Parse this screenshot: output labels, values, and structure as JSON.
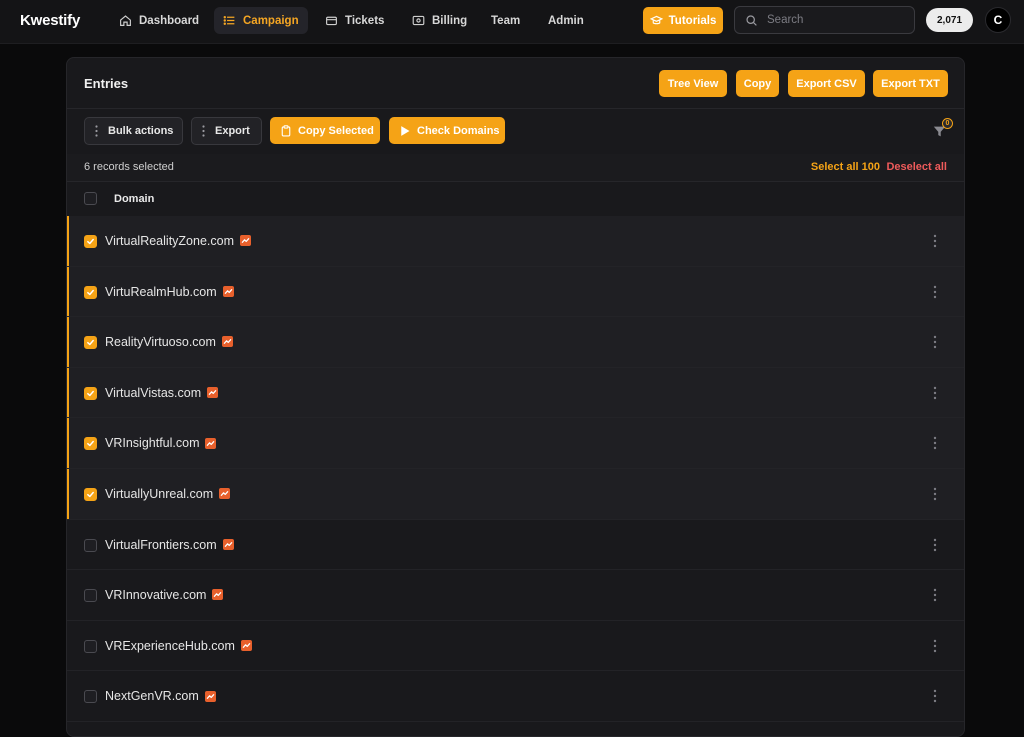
{
  "app": {
    "brand": "Kwestify"
  },
  "nav": {
    "items": [
      {
        "label": "Dashboard",
        "icon": "home-icon"
      },
      {
        "label": "Campaign",
        "icon": "list-icon",
        "active": true
      },
      {
        "label": "Tickets",
        "icon": "ticket-icon"
      },
      {
        "label": "Billing",
        "icon": "billing-icon"
      },
      {
        "label": "Team"
      },
      {
        "label": "Admin"
      }
    ],
    "tutorials_label": "Tutorials",
    "search_placeholder": "Search",
    "credits": "2,071",
    "avatar_initial": "C"
  },
  "card": {
    "title": "Entries",
    "header_buttons": [
      "Tree View",
      "Copy",
      "Export CSV",
      "Export TXT"
    ],
    "toolbar": {
      "bulk_actions": "Bulk actions",
      "export": "Export",
      "copy_selected": "Copy Selected",
      "check_domains": "Check Domains",
      "filter_count": "0"
    },
    "selection": {
      "count_text": "6 records selected",
      "select_all": "Select all 100",
      "deselect_all": "Deselect all"
    },
    "table": {
      "column": "Domain",
      "rows": [
        {
          "domain": "VirtualRealityZone.com",
          "selected": true
        },
        {
          "domain": "VirtuRealmHub.com",
          "selected": true
        },
        {
          "domain": "RealityVirtuoso.com",
          "selected": true
        },
        {
          "domain": "VirtualVistas.com",
          "selected": true
        },
        {
          "domain": "VRInsightful.com",
          "selected": true
        },
        {
          "domain": "VirtuallyUnreal.com",
          "selected": true
        },
        {
          "domain": "VirtualFrontiers.com",
          "selected": false
        },
        {
          "domain": "VRInnovative.com",
          "selected": false
        },
        {
          "domain": "VRExperienceHub.com",
          "selected": false
        },
        {
          "domain": "NextGenVR.com",
          "selected": false
        }
      ]
    }
  },
  "colors": {
    "accent": "#f5a316",
    "danger": "#ef5b5b",
    "trend": "#e8602c"
  }
}
